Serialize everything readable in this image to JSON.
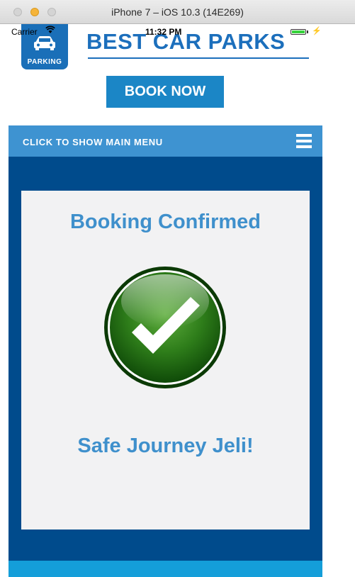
{
  "window": {
    "title": "iPhone 7 – iOS 10.3 (14E269)"
  },
  "status_bar": {
    "carrier": "Carrier",
    "wifi_icon": "wifi-icon",
    "time": "11:32 PM",
    "battery_level": 1.0,
    "battery_color": "#35d23a"
  },
  "header": {
    "logo_badge_label": "PARKING",
    "brand_title": "BEST CAR PARKS",
    "book_button_label": "BOOK NOW"
  },
  "menu": {
    "toggle_label": "CLICK TO SHOW MAIN MENU",
    "icon": "hamburger-icon"
  },
  "confirmation": {
    "title": "Booking Confirmed",
    "icon": "checkmark-icon",
    "message": "Safe Journey Jeli!"
  },
  "colors": {
    "brand_blue": "#1c6fbc",
    "menu_blue": "#3e93d1",
    "content_navy": "#004b8c",
    "heading_blue": "#3f90cc",
    "check_green": "#2e7d1a"
  }
}
